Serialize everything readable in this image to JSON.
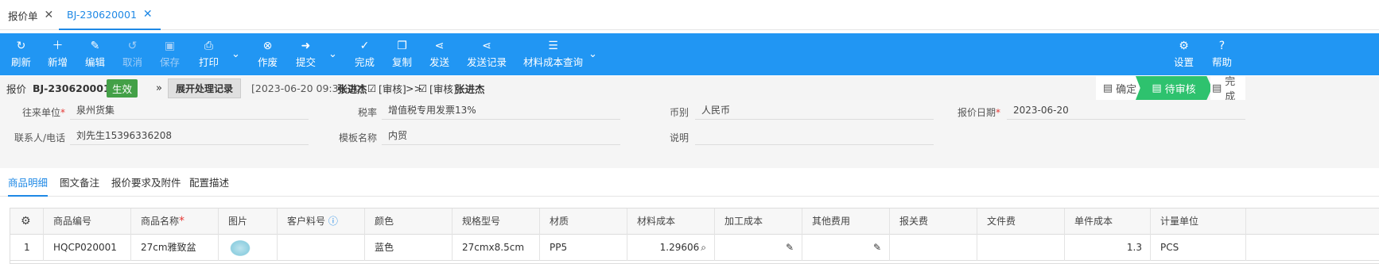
{
  "tabs": [
    {
      "label": "报价单"
    },
    {
      "label": "BJ-230620001"
    }
  ],
  "toolbar": {
    "refresh": "刷新",
    "add": "新增",
    "edit": "编辑",
    "cancel": "取消",
    "save": "保存",
    "print": "打印",
    "void": "作废",
    "submit": "提交",
    "finish": "完成",
    "copy": "复制",
    "send": "发送",
    "send_log": "发送记录",
    "material_cost": "材料成本查询",
    "settings": "设置",
    "help": "帮助"
  },
  "header": {
    "doc_type": "报价",
    "doc_no": "BJ-230620001",
    "status": "生效",
    "expand_btn": "展开处理记录",
    "log_time": "[2023-06-20 09:36:20]",
    "log_user": "张进杰",
    "log_action": "[审核]",
    "log_arrow": ">>",
    "log_action2": "[审核]",
    "log_user2": "张进杰"
  },
  "steps": {
    "confirm": "确定",
    "pending": "待审核",
    "done": "完成"
  },
  "form": {
    "partner_label": "往来单位",
    "partner": "泉州货集",
    "tax_label": "税率",
    "tax": "增值税专用发票13%",
    "currency_label": "币别",
    "currency": "人民币",
    "date_label": "报价日期",
    "date": "2023-06-20",
    "contact_label": "联系人/电话",
    "contact": "刘先生15396336208",
    "template_label": "模板名称",
    "template": "内贸",
    "note_label": "说明",
    "note": ""
  },
  "detail_tabs": [
    "商品明细",
    "图文备注",
    "报价要求及附件",
    "配置描述"
  ],
  "table": {
    "columns": [
      "商品编号",
      "商品名称",
      "图片",
      "客户料号",
      "颜色",
      "规格型号",
      "材质",
      "材料成本",
      "加工成本",
      "其他费用",
      "报关费",
      "文件费",
      "单件成本",
      "计量单位"
    ],
    "rows": [
      {
        "no": "1",
        "code": "HQCP020001",
        "name": "27cm雅致盆",
        "customer_no": "",
        "color": "蓝色",
        "spec": "27cmx8.5cm",
        "material": "PP5",
        "material_cost": "1.29606",
        "unit_cost": "1.3",
        "unit": "PCS"
      }
    ]
  },
  "colors": {
    "toolbar": "#2196f3",
    "accent": "#1e88e5",
    "status": "#43a047",
    "step": "#2ec26e"
  }
}
